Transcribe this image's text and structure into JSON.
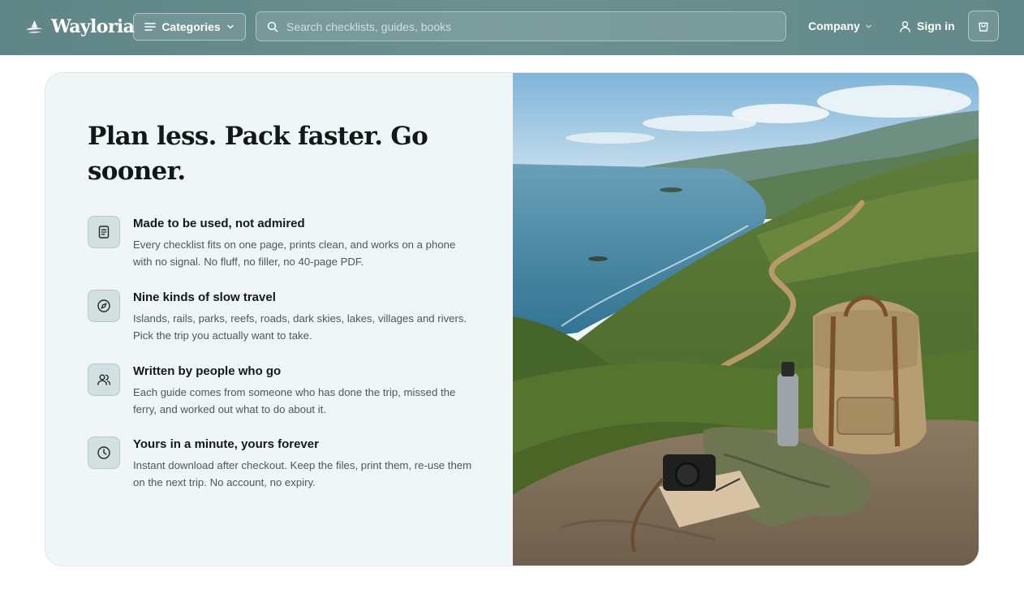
{
  "header": {
    "logo_text": "Wayloria",
    "categories_label": "Categories",
    "search_placeholder": "Search checklists, guides, books",
    "company_label": "Company",
    "signin_label": "Sign in"
  },
  "hero": {
    "title": "Plan less. Pack faster. Go sooner.",
    "features": [
      {
        "icon": "document-icon",
        "title": "Made to be used, not admired",
        "text": "Every checklist fits on one page, prints clean, and works on a phone with no signal. No fluff, no filler, no 40-page PDF."
      },
      {
        "icon": "compass-icon",
        "title": "Nine kinds of slow travel",
        "text": "Islands, rails, parks, reefs, roads, dark skies, lakes, villages and rivers. Pick the trip you actually want to take."
      },
      {
        "icon": "users-icon",
        "title": "Written by people who go",
        "text": "Each guide comes from someone who has done the trip, missed the ferry, and worked out what to do about it."
      },
      {
        "icon": "clock-icon",
        "title": "Yours in a minute, yours forever",
        "text": "Instant download after checkout. Keep the files, print them, re-use them on the next trip. No account, no expiry."
      }
    ],
    "image_icon": "coastal-hike-photo"
  },
  "colors": {
    "header_bg": "#628889",
    "panel_bg": "#f0f5f7",
    "badge_bg": "#d3e0e2",
    "heading_text": "#121816",
    "body_text": "#4e5856"
  }
}
